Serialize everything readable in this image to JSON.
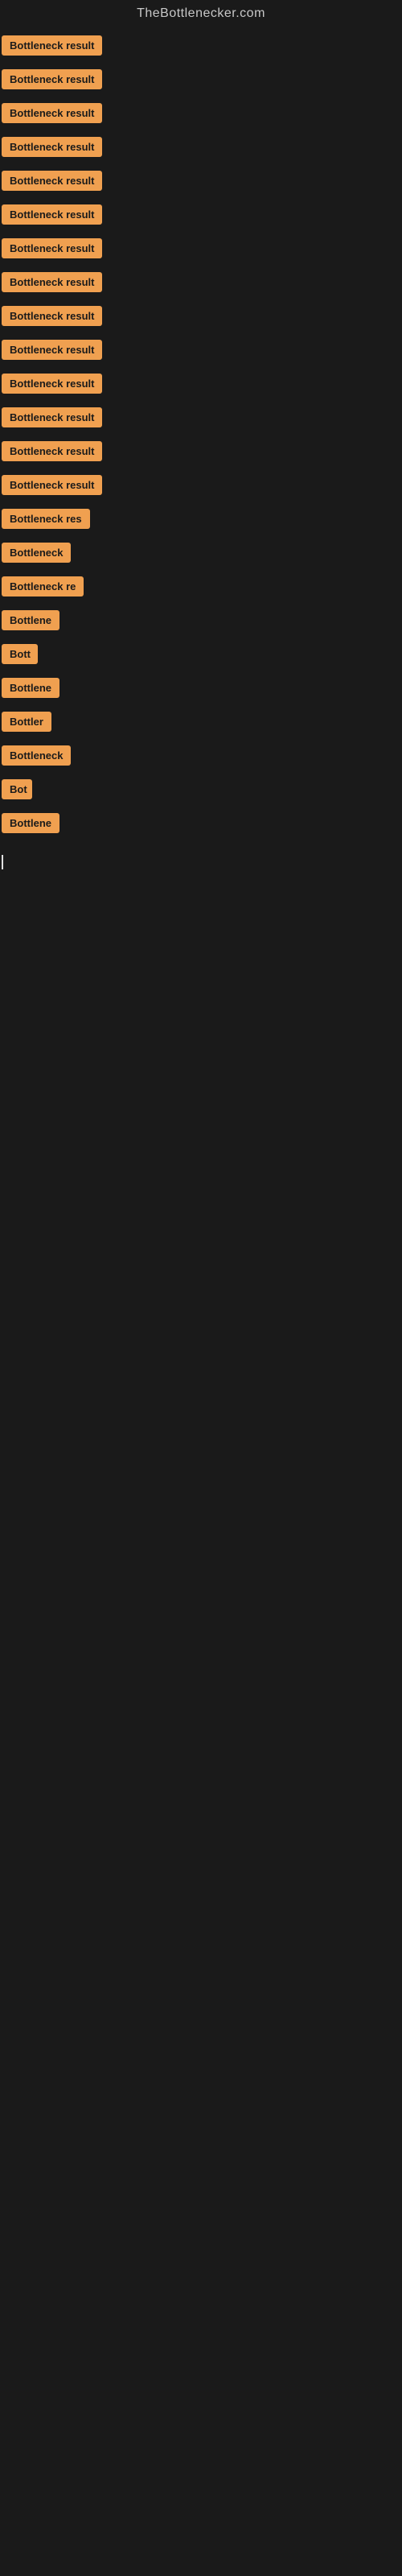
{
  "header": {
    "title": "TheBottlenecker.com"
  },
  "items": [
    {
      "id": 1,
      "label": "Bottleneck result",
      "width": "full"
    },
    {
      "id": 2,
      "label": "Bottleneck result",
      "width": "full"
    },
    {
      "id": 3,
      "label": "Bottleneck result",
      "width": "full"
    },
    {
      "id": 4,
      "label": "Bottleneck result",
      "width": "full"
    },
    {
      "id": 5,
      "label": "Bottleneck result",
      "width": "full"
    },
    {
      "id": 6,
      "label": "Bottleneck result",
      "width": "full"
    },
    {
      "id": 7,
      "label": "Bottleneck result",
      "width": "full"
    },
    {
      "id": 8,
      "label": "Bottleneck result",
      "width": "full"
    },
    {
      "id": 9,
      "label": "Bottleneck result",
      "width": "full"
    },
    {
      "id": 10,
      "label": "Bottleneck result",
      "width": "full"
    },
    {
      "id": 11,
      "label": "Bottleneck result",
      "width": "full"
    },
    {
      "id": 12,
      "label": "Bottleneck result",
      "width": "full"
    },
    {
      "id": 13,
      "label": "Bottleneck result",
      "width": "full"
    },
    {
      "id": 14,
      "label": "Bottleneck result",
      "width": "full"
    },
    {
      "id": 15,
      "label": "Bottleneck res",
      "width": "partial-1"
    },
    {
      "id": 16,
      "label": "Bottleneck",
      "width": "partial-2"
    },
    {
      "id": 17,
      "label": "Bottleneck re",
      "width": "partial-1b"
    },
    {
      "id": 18,
      "label": "Bottlene",
      "width": "partial-3"
    },
    {
      "id": 19,
      "label": "Bott",
      "width": "partial-4"
    },
    {
      "id": 20,
      "label": "Bottlene",
      "width": "partial-3"
    },
    {
      "id": 21,
      "label": "Bottler",
      "width": "partial-5"
    },
    {
      "id": 22,
      "label": "Bottleneck",
      "width": "partial-2"
    },
    {
      "id": 23,
      "label": "Bot",
      "width": "partial-6"
    },
    {
      "id": 24,
      "label": "Bottlene",
      "width": "partial-3"
    }
  ]
}
